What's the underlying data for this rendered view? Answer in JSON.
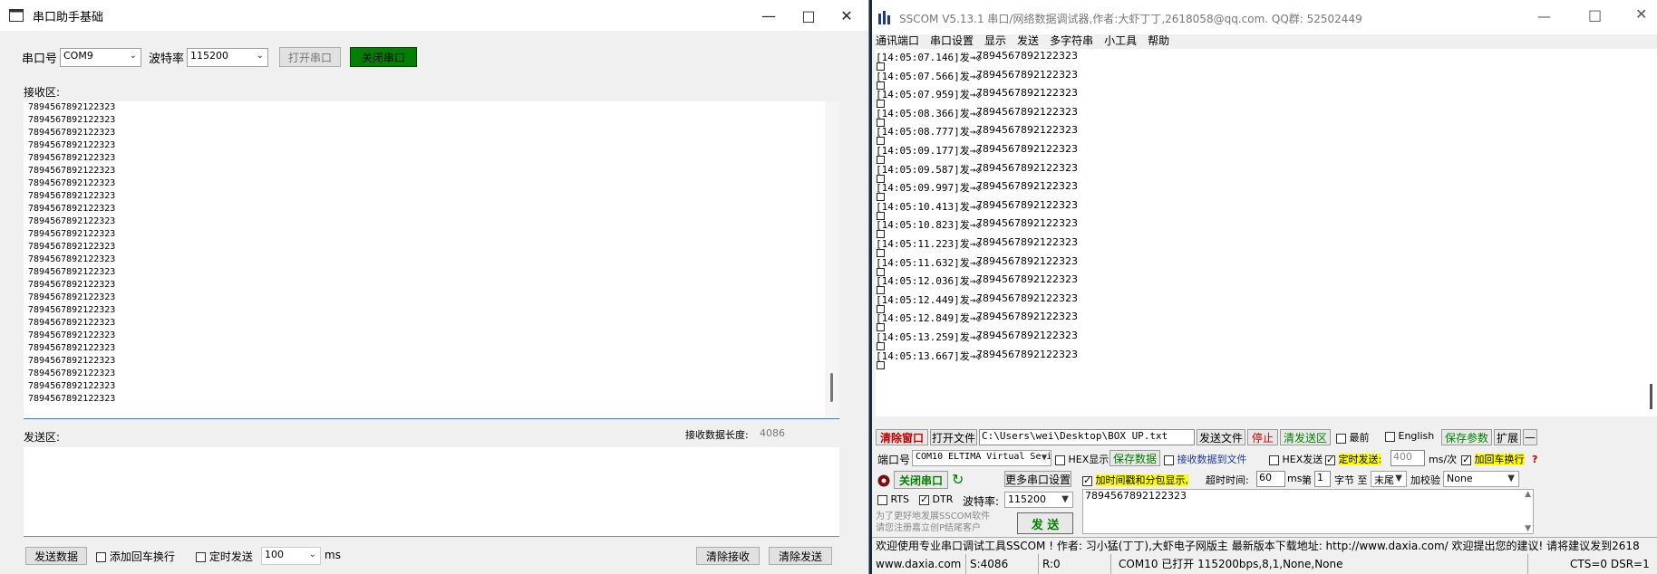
{
  "left": {
    "title": "串口助手基础",
    "port_label": "串口号",
    "port_value": "COM9",
    "baud_label": "波特率",
    "baud_value": "115200",
    "open_btn": "打开串口",
    "close_btn": "关闭串口",
    "recv_label": "接收区:",
    "recv_lines": [
      "7894567892122323",
      "7894567892122323",
      "7894567892122323",
      "7894567892122323",
      "7894567892122323",
      "7894567892122323",
      "7894567892122323",
      "7894567892122323",
      "7894567892122323",
      "7894567892122323",
      "7894567892122323",
      "7894567892122323",
      "7894567892122323",
      "7894567892122323",
      "7894567892122323",
      "7894567892122323",
      "7894567892122323",
      "7894567892122323",
      "7894567892122323",
      "7894567892122323",
      "7894567892122323",
      "7894567892122323",
      "7894567892122323",
      "7894567892122323"
    ],
    "send_label": "发送区:",
    "recv_len_label": "接收数据长度:",
    "recv_len_value": "4086",
    "send_btn": "发送数据",
    "add_crlf": "添加回车换行",
    "timed_send": "定时发送",
    "interval_value": "100",
    "interval_unit": "ms",
    "clear_recv": "清除接收",
    "clear_send": "清除发送"
  },
  "right": {
    "title": "SSCOM V5.13.1 串口/网络数据调试器,作者:大虾丁丁,2618058@qq.com. QQ群: 52502449",
    "menu": [
      "通讯端口",
      "串口设置",
      "显示",
      "发送",
      "多字符串",
      "小工具",
      "帮助"
    ],
    "log": [
      {
        "time": "[14:05:07.146]发→◇",
        "data": "7894567892122323"
      },
      {
        "time": "[14:05:07.566]发→◇",
        "data": "7894567892122323"
      },
      {
        "time": "[14:05:07.959]发→◇",
        "data": "7894567892122323"
      },
      {
        "time": "[14:05:08.366]发→◇",
        "data": "7894567892122323"
      },
      {
        "time": "[14:05:08.777]发→◇",
        "data": "7894567892122323"
      },
      {
        "time": "[14:05:09.177]发→◇",
        "data": "7894567892122323"
      },
      {
        "time": "[14:05:09.587]发→◇",
        "data": "7894567892122323"
      },
      {
        "time": "[14:05:09.997]发→◇",
        "data": "7894567892122323"
      },
      {
        "time": "[14:05:10.413]发→◇",
        "data": "7894567892122323"
      },
      {
        "time": "[14:05:10.823]发→◇",
        "data": "7894567892122323"
      },
      {
        "time": "[14:05:11.223]发→◇",
        "data": "7894567892122323"
      },
      {
        "time": "[14:05:11.632]发→◇",
        "data": "7894567892122323"
      },
      {
        "time": "[14:05:12.036]发→◇",
        "data": "7894567892122323"
      },
      {
        "time": "[14:05:12.449]发→◇",
        "data": "7894567892122323"
      },
      {
        "time": "[14:05:12.849]发→◇",
        "data": "7894567892122323"
      },
      {
        "time": "[14:05:13.259]发→◇",
        "data": "7894567892122323"
      },
      {
        "time": "[14:05:13.667]发→◇",
        "data": "7894567892122323"
      }
    ],
    "clear_window": "清除窗口",
    "open_file": "打开文件",
    "file_path": "C:\\Users\\wei\\Desktop\\BOX UP.txt",
    "send_file": "发送文件",
    "stop": "停止",
    "clear_send_area": "清发送区",
    "topmost": "最前",
    "english": "English",
    "save_params": "保存参数",
    "expand": "扩展",
    "port_label": "端口号",
    "port_value": "COM10 ELTIMA Virtual Seria",
    "hex_display": "HEX显示",
    "save_data": "保存数据",
    "recv_to_file": "接收数据到文件",
    "hex_send": "HEX发送",
    "timed_send": "定时发送:",
    "timed_value": "400",
    "timed_unit": "ms/次",
    "add_crlf": "加回车换行",
    "close_port": "关闭串口",
    "more_settings": "更多串口设置",
    "add_timestamp": "加时间戳和分包显示,",
    "timeout_label": "超时时间:",
    "timeout_value": "60",
    "timeout_unit": "ms",
    "byte_label": "第",
    "byte_value": "1",
    "byte_to": "字节 至",
    "byte_end": "末尾",
    "checksum_label": "加校验",
    "checksum_value": "None",
    "rts": "RTS",
    "dtr": "DTR",
    "baud_label": "波特率:",
    "baud_value": "115200",
    "send_text": "7894567892122323",
    "promo": "为了更好地发展SSCOM软件\n请您注册嘉立创P结尾客户",
    "send_btn": "发 送",
    "ticker": "欢迎使用专业串口调试工具SSCOM ! 作者: 习小猛(丁丁),大虾电子网版主 最新版本下载地址: http://www.daxia.com/ 欢迎提出您的建议! 请将建议发到2618",
    "status": {
      "site": "www.daxia.com",
      "sent": "S:4086",
      "recv": "R:0",
      "port": "COM10 已打开 115200bps,8,1,None,None",
      "lines": "CTS=0 DSR=1"
    }
  }
}
